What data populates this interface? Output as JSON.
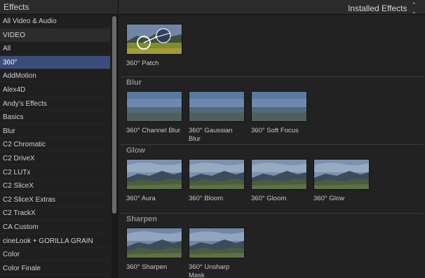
{
  "header": {
    "title": "Effects",
    "menu_label": "Installed Effects",
    "menu_icon": "chevron-updown-icon"
  },
  "sidebar": {
    "items": [
      {
        "label": "All Video & Audio",
        "type": "item"
      },
      {
        "label": "VIDEO",
        "type": "header"
      },
      {
        "label": "All",
        "type": "item"
      },
      {
        "label": "360°",
        "type": "selected"
      },
      {
        "label": "AddMotion",
        "type": "item"
      },
      {
        "label": "Alex4D",
        "type": "item"
      },
      {
        "label": "Andy's Effects",
        "type": "item"
      },
      {
        "label": "Basics",
        "type": "item"
      },
      {
        "label": "Blur",
        "type": "item"
      },
      {
        "label": "C2 Chromatic",
        "type": "item"
      },
      {
        "label": "C2 DriveX",
        "type": "item"
      },
      {
        "label": "C2 LUTx",
        "type": "item"
      },
      {
        "label": "C2 SliceX",
        "type": "item"
      },
      {
        "label": "C2 SliceX Extras",
        "type": "item"
      },
      {
        "label": "C2 TrackX",
        "type": "item"
      },
      {
        "label": "CA Custom",
        "type": "item"
      },
      {
        "label": "cineLook + GORILLA GRAIN",
        "type": "item"
      },
      {
        "label": "Color",
        "type": "item"
      },
      {
        "label": "Color Finale",
        "type": "item"
      }
    ]
  },
  "main": {
    "top_tiles": [
      {
        "label": "360° Patch",
        "thumb": "patch"
      }
    ],
    "sections": [
      {
        "title": "Blur",
        "tiles": [
          {
            "label": "360° Channel Blur",
            "thumb": "blur"
          },
          {
            "label": "360° Gaussian Blur",
            "thumb": "blur"
          },
          {
            "label": "360° Soft Focus",
            "thumb": "blur"
          }
        ]
      },
      {
        "title": "Glow",
        "tiles": [
          {
            "label": "360° Aura",
            "thumb": "glow"
          },
          {
            "label": "360° Bloom",
            "thumb": "glow"
          },
          {
            "label": "360° Gloom",
            "thumb": "glow"
          },
          {
            "label": "360° Glow",
            "thumb": "glow"
          }
        ]
      },
      {
        "title": "Sharpen",
        "tiles": [
          {
            "label": "360° Sharpen",
            "thumb": "sharp"
          },
          {
            "label": "360° Unsharp Mask",
            "thumb": "sharp"
          }
        ]
      }
    ]
  }
}
